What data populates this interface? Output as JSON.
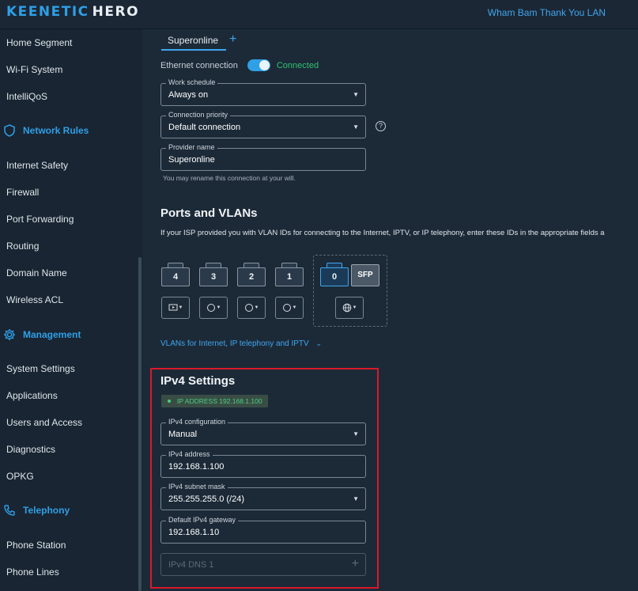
{
  "header": {
    "logo_part1": "KEENETIC",
    "logo_part2": "HERO",
    "network_name": "Wham Bam Thank You LAN"
  },
  "sidebar": {
    "items_top": [
      "Home Segment",
      "Wi-Fi System",
      "IntelliQoS"
    ],
    "section_network_rules": "Network Rules",
    "items_network_rules": [
      "Internet Safety",
      "Firewall",
      "Port Forwarding",
      "Routing",
      "Domain Name",
      "Wireless ACL"
    ],
    "section_management": "Management",
    "items_management": [
      "System Settings",
      "Applications",
      "Users and Access",
      "Diagnostics",
      "OPKG"
    ],
    "section_telephony": "Telephony",
    "items_telephony": [
      "Phone Station",
      "Phone Lines"
    ]
  },
  "tabs": {
    "active_label": "Superonline",
    "add_label": "+"
  },
  "ethernet": {
    "label": "Ethernet connection",
    "status": "Connected",
    "enabled": true
  },
  "fields": {
    "work_schedule_label": "Work schedule",
    "work_schedule_value": "Always on",
    "priority_label": "Connection priority",
    "priority_value": "Default connection",
    "provider_label": "Provider name",
    "provider_value": "Superonline",
    "provider_hint": "You may rename this connection at your will."
  },
  "ports": {
    "title": "Ports and VLANs",
    "description": "If your ISP provided you with VLAN IDs for connecting to the Internet, IPTV, or IP telephony, enter these IDs in the appropriate fields a",
    "lan_ports": [
      "4",
      "3",
      "2",
      "1"
    ],
    "wan_port": "0",
    "sfp_label": "SFP",
    "port_icons": [
      "tv-icon",
      "circle-icon",
      "circle-icon",
      "circle-icon",
      "globe-icon"
    ],
    "vlan_link": "VLANs for Internet, IP telephony and IPTV"
  },
  "ipv4": {
    "title": "IPv4 Settings",
    "ip_badge": "IP ADDRESS 192.168.1.100",
    "config_label": "IPv4 configuration",
    "config_value": "Manual",
    "address_label": "IPv4 address",
    "address_value": "192.168.1.100",
    "mask_label": "IPv4 subnet mask",
    "mask_value": "255.255.255.0 (/24)",
    "gateway_label": "Default IPv4 gateway",
    "gateway_value": "192.168.1.10",
    "dns_placeholder": "IPv4 DNS 1"
  },
  "colors": {
    "accent": "#2f9fe6",
    "connected": "#2ec26d",
    "highlight_border": "#d8192a",
    "background": "#1c2a38"
  }
}
